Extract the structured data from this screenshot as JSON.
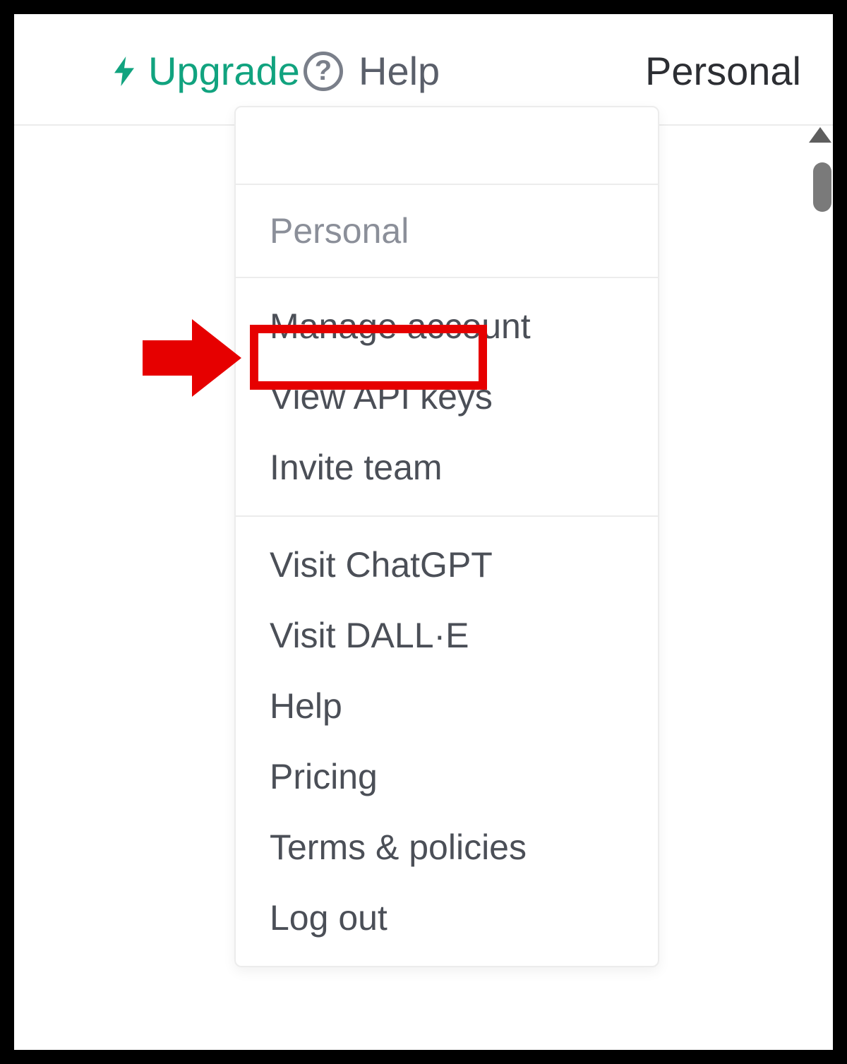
{
  "topbar": {
    "upgrade_label": "Upgrade",
    "help_label": "Help",
    "personal_label": "Personal"
  },
  "dropdown": {
    "title": "Personal",
    "group1": {
      "manage_account": "Manage account",
      "view_api_keys": "View API keys",
      "invite_team": "Invite team"
    },
    "group2": {
      "visit_chatgpt": "Visit ChatGPT",
      "visit_dalle": "Visit DALL·E",
      "help": "Help",
      "pricing": "Pricing",
      "terms": "Terms & policies",
      "logout": "Log out"
    }
  },
  "colors": {
    "accent_green": "#11a37f",
    "highlight_red": "#e60000"
  }
}
